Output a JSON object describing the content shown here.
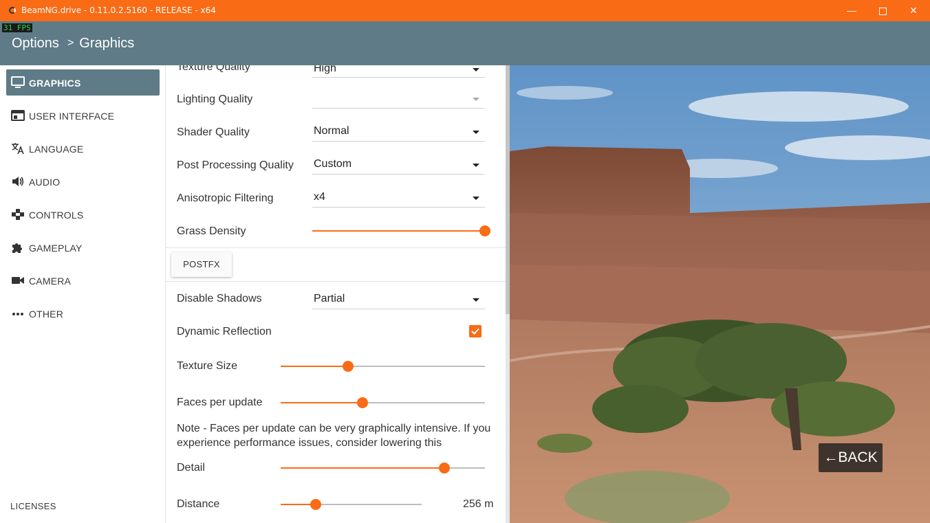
{
  "window": {
    "title": "BeamNG.drive - 0.11.0.2.5160 - RELEASE - x64",
    "minimize_glyph": "—",
    "close_glyph": "✕"
  },
  "header": {
    "fps": "31 FPS",
    "breadcrumb_root": "Options",
    "breadcrumb_sep": ">",
    "breadcrumb_current": "Graphics"
  },
  "sidebar": {
    "items": [
      {
        "label": "GRAPHICS",
        "icon": "monitor-icon"
      },
      {
        "label": "USER INTERFACE",
        "icon": "window-icon"
      },
      {
        "label": "LANGUAGE",
        "icon": "translate-icon"
      },
      {
        "label": "AUDIO",
        "icon": "speaker-icon"
      },
      {
        "label": "CONTROLS",
        "icon": "gamepad-icon"
      },
      {
        "label": "GAMEPLAY",
        "icon": "puzzle-icon"
      },
      {
        "label": "CAMERA",
        "icon": "video-camera-icon"
      },
      {
        "label": "OTHER",
        "icon": "more-dots-icon"
      }
    ],
    "licenses": "LICENSES"
  },
  "settings": {
    "texture_quality": {
      "label": "Texture Quality",
      "value": "High"
    },
    "lighting_quality": {
      "label": "Lighting Quality",
      "value": ""
    },
    "shader_quality": {
      "label": "Shader Quality",
      "value": "Normal"
    },
    "post_processing_quality": {
      "label": "Post Processing Quality",
      "value": "Custom"
    },
    "anisotropic_filtering": {
      "label": "Anisotropic Filtering",
      "value": "x4"
    },
    "grass_density": {
      "label": "Grass Density",
      "fraction": 1.0
    },
    "postfx_button": "POSTFX",
    "disable_shadows": {
      "label": "Disable Shadows",
      "value": "Partial"
    },
    "dynamic_reflection": {
      "label": "Dynamic Reflection",
      "checked": true
    },
    "texture_size": {
      "label": "Texture Size",
      "fraction": 0.33
    },
    "faces_per_update": {
      "label": "Faces per update",
      "fraction": 0.4
    },
    "note": "Note - Faces per update can be very graphically intensive. If you experience performance issues, consider lowering this",
    "detail": {
      "label": "Detail",
      "fraction": 0.8
    },
    "distance": {
      "label": "Distance",
      "fraction": 0.25,
      "value": "256 m"
    }
  },
  "back_button": {
    "arrow": "←",
    "label": "BACK"
  },
  "colors": {
    "accent": "#f96b15",
    "header": "#5f7b87"
  }
}
